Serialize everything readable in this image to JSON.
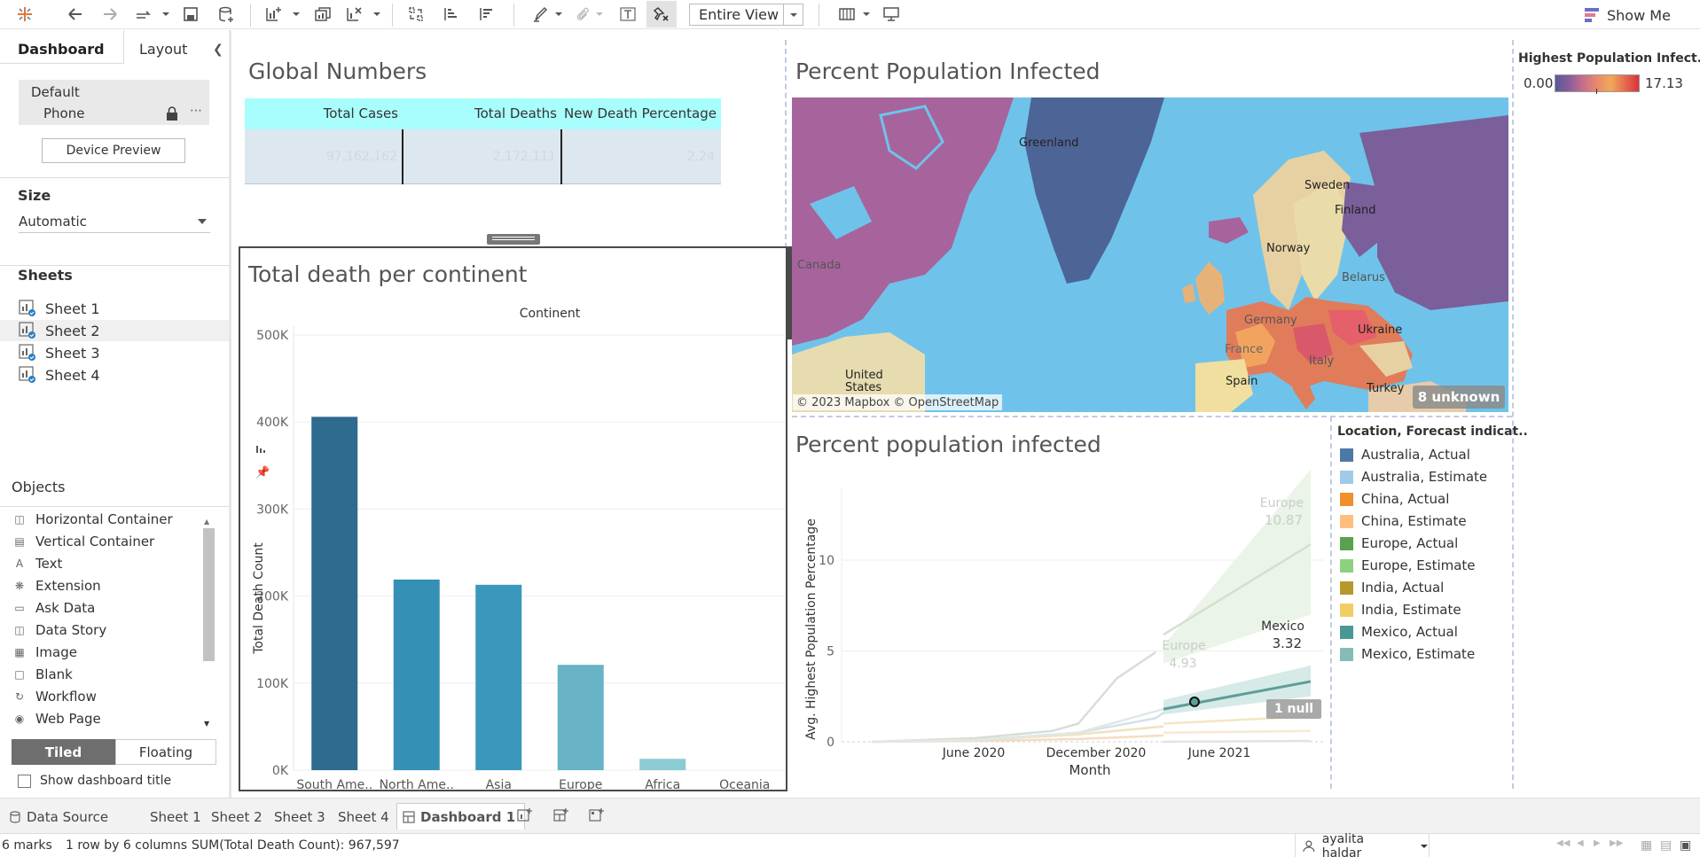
{
  "toolbar": {
    "fit_select": "Entire View",
    "show_me_label": "Show Me",
    "icons": [
      "tableau-logo-icon",
      "undo-icon",
      "redo-icon",
      "replay-icon",
      "save-icon",
      "new-datasource-icon",
      "new-worksheet-icon",
      "duplicate-sheet-icon",
      "clear-sheet-icon",
      "swap-icon",
      "sort-ascending-icon",
      "sort-descending-icon",
      "highlight-icon",
      "paperclip-icon",
      "text-label-icon",
      "pin-clear-icon",
      "view-cards-icon",
      "presentation-icon"
    ]
  },
  "left_panel": {
    "tabs": [
      {
        "label": "Dashboard"
      },
      {
        "label": "Layout"
      }
    ],
    "device": {
      "default": "Default",
      "phone": "Phone"
    },
    "device_preview": "Device Preview",
    "size_label": "Size",
    "size_value": "Automatic",
    "sheets_label": "Sheets",
    "sheets": [
      {
        "label": "Sheet 1"
      },
      {
        "label": "Sheet 2"
      },
      {
        "label": "Sheet 3"
      },
      {
        "label": "Sheet 4"
      }
    ],
    "objects_label": "Objects",
    "objects": [
      {
        "label": "Horizontal Container",
        "icon": "horizontal-container-icon"
      },
      {
        "label": "Vertical Container",
        "icon": "vertical-container-icon"
      },
      {
        "label": "Text",
        "icon": "text-icon"
      },
      {
        "label": "Extension",
        "icon": "extension-icon"
      },
      {
        "label": "Ask Data",
        "icon": "ask-data-icon"
      },
      {
        "label": "Data Story",
        "icon": "data-story-icon"
      },
      {
        "label": "Image",
        "icon": "image-icon"
      },
      {
        "label": "Blank",
        "icon": "blank-icon"
      },
      {
        "label": "Workflow",
        "icon": "workflow-icon"
      },
      {
        "label": "Web Page",
        "icon": "web-page-icon"
      }
    ],
    "tiled": "Tiled",
    "floating": "Floating",
    "show_title": "Show dashboard title"
  },
  "global_numbers": {
    "title": "Global Numbers",
    "headers": [
      "Total Cases",
      "Total Deaths",
      "New Death Percentage"
    ],
    "values": [
      "97,162,162",
      "2,172,111",
      "2.24"
    ],
    "header_color": "#a8fdfd"
  },
  "bar_chart": {
    "title": "Total death per continent",
    "column_header": "Continent",
    "ylabel": "Total Death Count",
    "y_ticks": [
      "500K",
      "400K",
      "300K",
      "200K",
      "100K",
      "0K"
    ]
  },
  "map": {
    "title": "Percent Population Infected",
    "credit": "© 2023 Mapbox © OpenStreetMap",
    "unknown": "8 unknown",
    "labels": [
      "Greenland",
      "Sweden",
      "Finland",
      "Norway",
      "Belarus",
      "Germany",
      "Ukraine",
      "France",
      "Italy",
      "Spain",
      "Turkey",
      "United States",
      "Canada"
    ],
    "legend_title": "Highest Population Infect..",
    "legend_min": "0.00",
    "legend_max": "17.13"
  },
  "line_chart": {
    "title": "Percent population infected",
    "ylabel": "Avg. Highest Population Percentage",
    "xlabel": "Month",
    "x_ticks": [
      "June 2020",
      "December 2020",
      "June 2021"
    ],
    "y_ticks": [
      "10",
      "5",
      "0"
    ],
    "labels": {
      "europe_end": "Europe",
      "europe_end_val": "10.87",
      "europe_mid": "Europe",
      "europe_mid_val": "4.93",
      "mexico": "Mexico",
      "mexico_val": "3.32"
    },
    "null_pill": "1 null",
    "legend_title": "Location, Forecast indicat..",
    "legend": [
      {
        "label": "Australia, Actual",
        "color": "#4e79a7"
      },
      {
        "label": "Australia, Estimate",
        "color": "#a0cbe8"
      },
      {
        "label": "China, Actual",
        "color": "#f28e2b"
      },
      {
        "label": "China, Estimate",
        "color": "#ffbe7d"
      },
      {
        "label": "Europe, Actual",
        "color": "#59a14f"
      },
      {
        "label": "Europe, Estimate",
        "color": "#8cd17d"
      },
      {
        "label": "India, Actual",
        "color": "#b6992d"
      },
      {
        "label": "India, Estimate",
        "color": "#f1ce63"
      },
      {
        "label": "Mexico, Actual",
        "color": "#499894"
      },
      {
        "label": "Mexico, Estimate",
        "color": "#86bcb6"
      }
    ]
  },
  "chart_data": [
    {
      "type": "bar",
      "title": "Total death per continent",
      "xlabel": "Continent",
      "ylabel": "Total Death Count",
      "categories": [
        "South Ame..",
        "North Ame..",
        "Asia",
        "Europe",
        "Africa",
        "Oceania"
      ],
      "values": [
        406000,
        219000,
        213000,
        121000,
        13000,
        0
      ],
      "colors": [
        "#2e6b8e",
        "#3490b4",
        "#3a98bc",
        "#68b3c5",
        "#8ccbd3",
        "#a9d9dd"
      ],
      "ylim": [
        0,
        500000
      ],
      "grid": true
    },
    {
      "type": "line",
      "title": "Percent population infected",
      "xlabel": "Month",
      "ylabel": "Avg. Highest Population Percentage",
      "ylim": [
        0,
        14
      ],
      "x_ticks": [
        "June 2020",
        "December 2020",
        "June 2021"
      ],
      "series": [
        {
          "name": "Europe",
          "x": [
            "2020-02",
            "2020-06",
            "2020-10",
            "2021-01",
            "2021-04",
            "2021-07"
          ],
          "values": [
            0.0,
            0.2,
            1.0,
            4.93,
            7.9,
            10.87
          ]
        },
        {
          "name": "Mexico",
          "x": [
            "2020-02",
            "2020-06",
            "2020-10",
            "2021-01",
            "2021-04",
            "2021-07"
          ],
          "values": [
            0.0,
            0.1,
            0.5,
            1.8,
            2.6,
            3.32
          ]
        }
      ]
    }
  ],
  "tabs": {
    "data_source": "Data Source",
    "sheets": [
      "Sheet 1",
      "Sheet 2",
      "Sheet 3",
      "Sheet 4"
    ],
    "active": "Dashboard 1"
  },
  "status": {
    "marks": "6 marks",
    "rows": "1 row by 6 columns",
    "sum": "SUM(Total Death Count): 967,597",
    "user": "ayalita haldar"
  }
}
